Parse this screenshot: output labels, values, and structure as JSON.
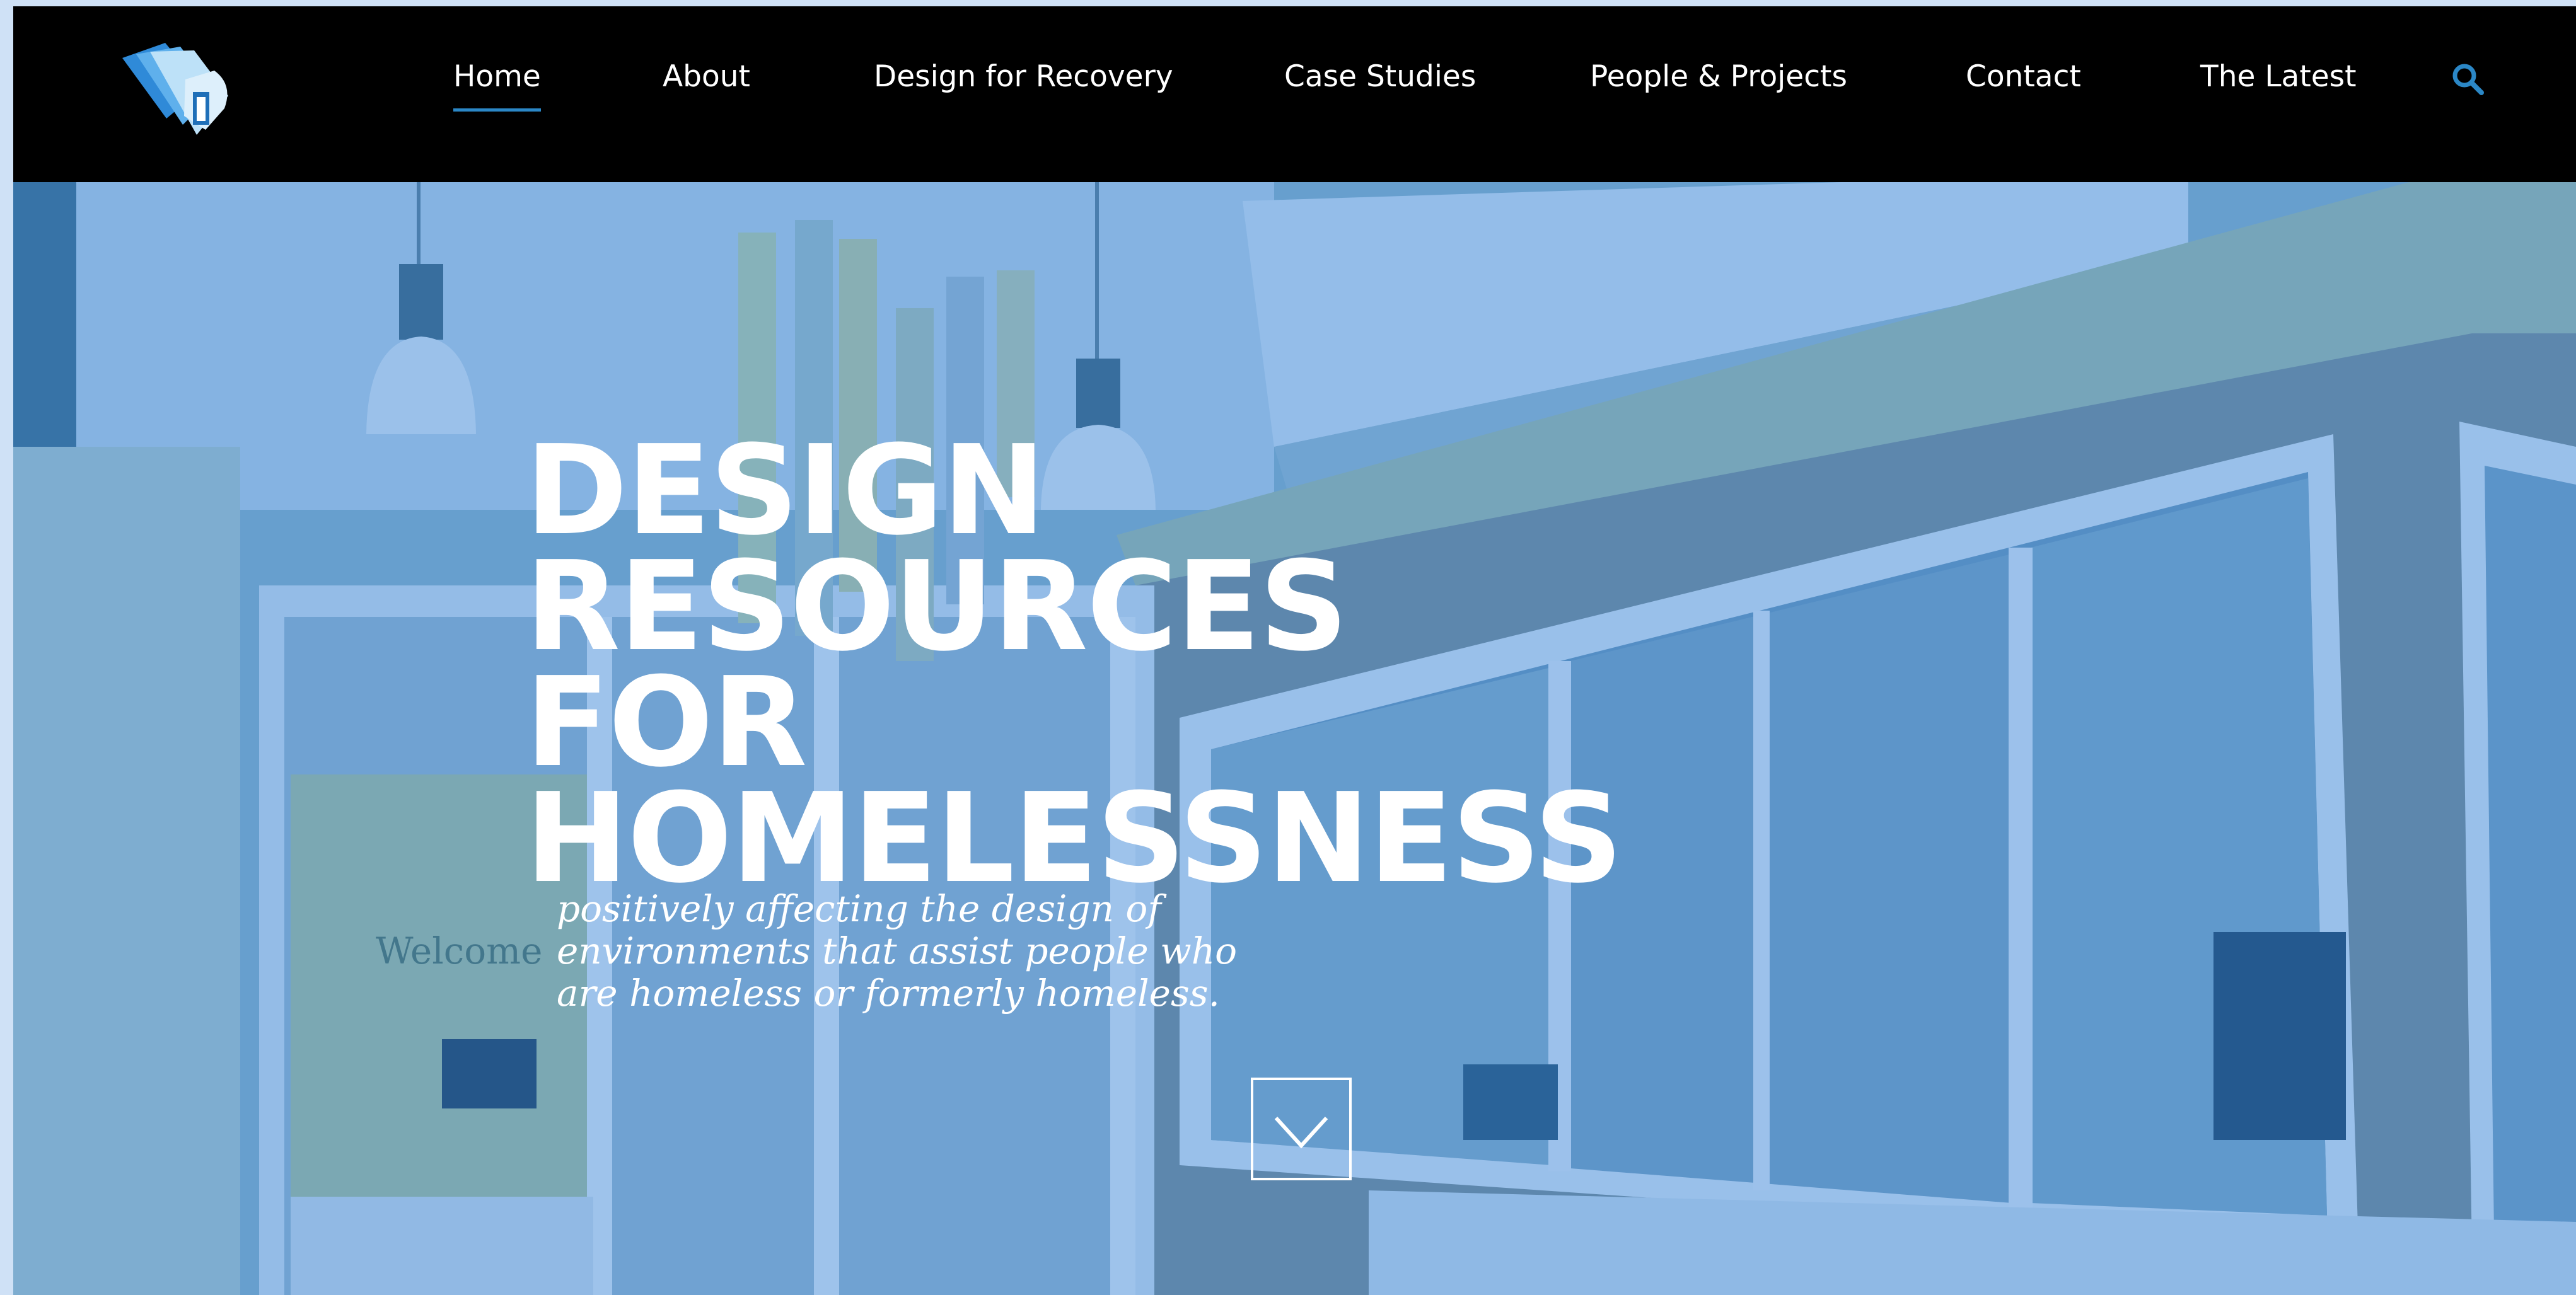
{
  "nav": {
    "items": [
      {
        "label": "Home",
        "active": true
      },
      {
        "label": "About"
      },
      {
        "label": "Design for Recovery"
      },
      {
        "label": "Case Studies"
      },
      {
        "label": "People & Projects"
      },
      {
        "label": "Contact"
      },
      {
        "label": "The Latest"
      }
    ],
    "search_icon": "search-icon",
    "logo_icon": "layered-pages-logo-icon"
  },
  "hero": {
    "title_lines": [
      "DESIGN",
      "RESOURCES",
      "FOR",
      "HOMELESSNESS"
    ],
    "subtitle": "positively affecting the design of environments that assist people who are homeless or formerly homeless.",
    "scroll_icon": "chevron-down-icon",
    "overlay_color": "#2f7fd6",
    "signage": "Welcome"
  },
  "colors": {
    "accent": "#2b87c6",
    "nav_bg": "#000000",
    "text": "#ffffff"
  }
}
